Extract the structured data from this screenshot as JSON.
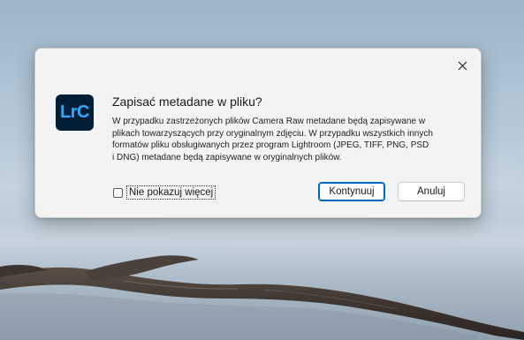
{
  "dialog": {
    "app_logo_text": "LrC",
    "title": "Zapisać metadane w pliku?",
    "message_lines": [
      "W przypadku zastrzeżonych plików Camera Raw metadane będą zapisywane w",
      "plikach towarzyszących przy oryginalnym zdjęciu. W przypadku wszystkich innych",
      "formatów pliku obsługiwanych przez program Lightroom (JPEG, TIFF, PNG, PSD",
      "i DNG) metadane będą zapisywane w oryginalnych plików."
    ],
    "dont_show_label": "Nie pokazuj więcej",
    "dont_show_checked": false,
    "continue_label": "Kontynuuj",
    "cancel_label": "Anuluj",
    "close_icon": "close-icon"
  },
  "colors": {
    "accent": "#0067c0",
    "logo_bg": "#001e36",
    "logo_fg": "#31a8ff",
    "dialog_bg": "#f3f3f3"
  }
}
